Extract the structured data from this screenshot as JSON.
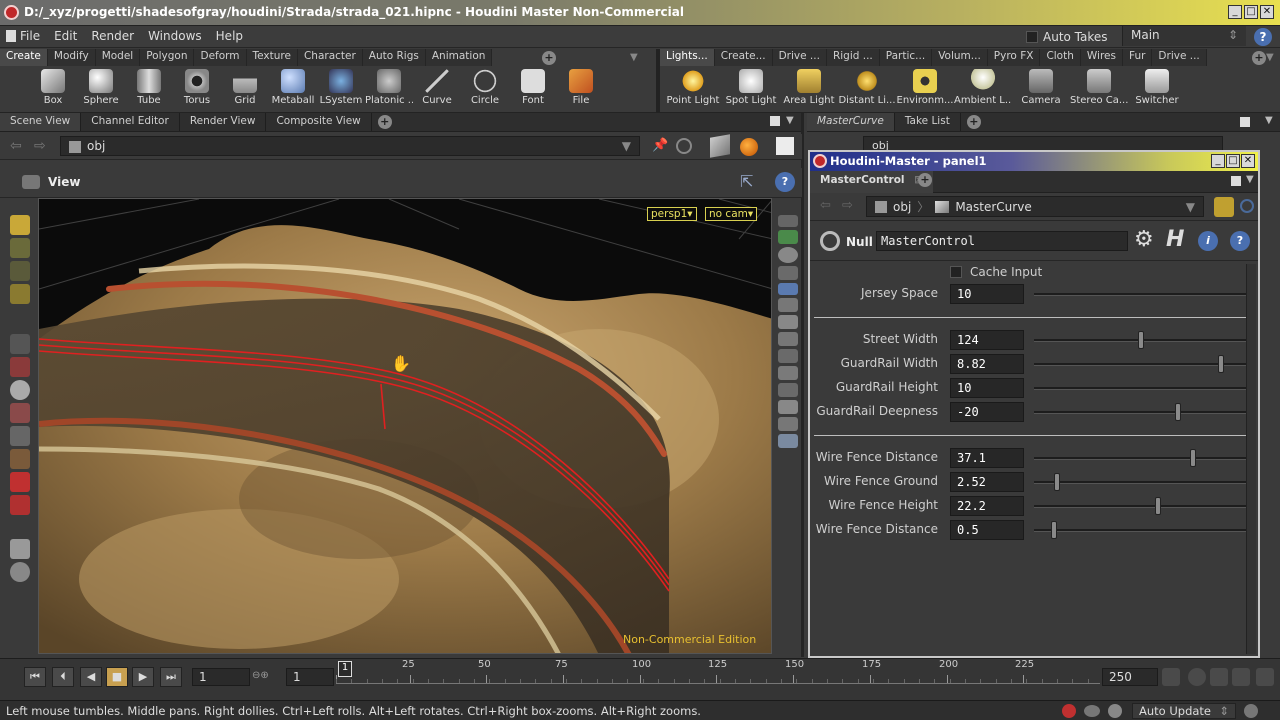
{
  "window": {
    "title": "D:/_xyz/progetti/shadesofgray/houdini/Strada/strada_021.hipnc - Houdini Master Non-Commercial"
  },
  "menubar": {
    "items": [
      "File",
      "Edit",
      "Render",
      "Windows",
      "Help"
    ],
    "auto_takes_label": "Auto Takes",
    "take_select": "Main"
  },
  "shelf_left": {
    "tabs": [
      "Create",
      "Modify",
      "Model",
      "Polygon",
      "Deform",
      "Texture",
      "Character",
      "Auto Rigs",
      "Animation"
    ],
    "active_tab": "Create",
    "tools": [
      "Box",
      "Sphere",
      "Tube",
      "Torus",
      "Grid",
      "Metaball",
      "LSystem",
      "Platonic ...",
      "Curve",
      "Circle",
      "Font",
      "File"
    ]
  },
  "shelf_right": {
    "tabs": [
      "Lights...",
      "Create...",
      "Drive ...",
      "Rigid ...",
      "Partic...",
      "Volum...",
      "Pyro FX",
      "Cloth",
      "Wires",
      "Fur",
      "Drive ..."
    ],
    "active_tab": "Lights...",
    "tools": [
      "Point Light",
      "Spot Light",
      "Area Light",
      "Distant Li...",
      "Environm...",
      "Ambient L...",
      "Camera",
      "Stereo Ca...",
      "Switcher"
    ]
  },
  "left_pane": {
    "tabs": [
      "Scene View",
      "Channel Editor",
      "Render View",
      "Composite View"
    ],
    "active_tab": "Scene View",
    "path": "obj",
    "view_label": "View",
    "camera_menu": "persp1",
    "cam_menu": "no cam",
    "watermark": "Non-Commercial Edition"
  },
  "right_pane": {
    "tabs": [
      "MasterCurve",
      "Take List"
    ],
    "path": "obj"
  },
  "panel": {
    "title": "Houdini-Master - panel1",
    "tab": "MasterControl",
    "crumbs": [
      "obj",
      "MasterCurve"
    ],
    "node_type": "Null",
    "node_name": "MasterControl",
    "cache_input_label": "Cache Input",
    "parms": [
      {
        "label": "Jersey Space",
        "value": "10",
        "slider": 1.0
      },
      {
        "label": "Street Width",
        "value": "124",
        "slider": 0.49
      },
      {
        "label": "GuardRail Width",
        "value": "8.82",
        "slider": 0.86
      },
      {
        "label": "GuardRail Height",
        "value": "10",
        "slider": 1.0
      },
      {
        "label": "GuardRail Deepness",
        "value": "-20",
        "slider": 0.66
      },
      {
        "label": "Wire Fence Distance",
        "value": "37.1",
        "slider": 0.73
      },
      {
        "label": "Wire Fence Ground",
        "value": "2.52",
        "slider": 0.1
      },
      {
        "label": "Wire Fence Height",
        "value": "22.2",
        "slider": 0.57
      },
      {
        "label": "Wire Fence Distance",
        "value": "0.5",
        "slider": 0.09
      }
    ]
  },
  "timeline": {
    "current_frame": "1",
    "start_frame": "1",
    "end_frame": "250",
    "ticks": [
      "1",
      "25",
      "50",
      "75",
      "100",
      "125",
      "150",
      "175",
      "200",
      "225"
    ]
  },
  "status": {
    "text": "Left mouse tumbles. Middle pans. Right dollies. Ctrl+Left rolls. Alt+Left rotates. Ctrl+Right box-zooms. Alt+Right zooms.",
    "auto_update": "Auto Update"
  }
}
